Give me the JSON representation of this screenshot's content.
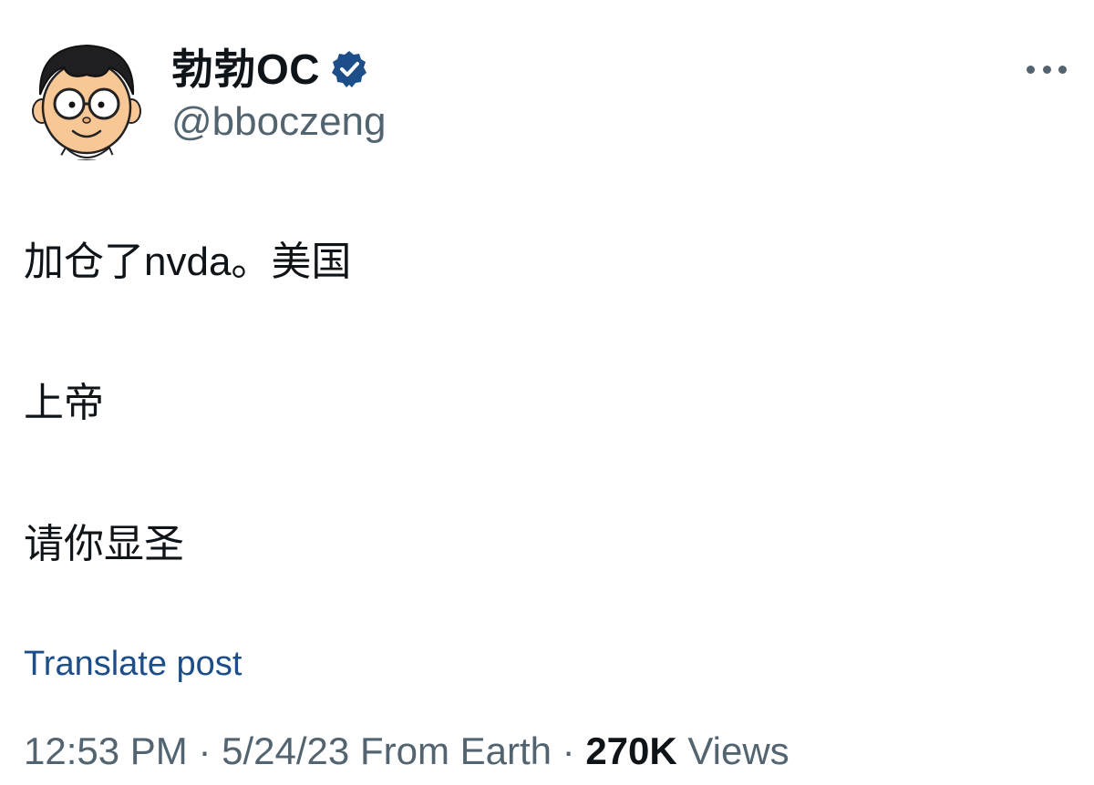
{
  "author": {
    "display_name": "勃勃OC",
    "handle": "@bboczeng",
    "verified": true,
    "avatar_icon": "cartoon-boy-glasses-avatar",
    "verified_color": "#1d4e89"
  },
  "post": {
    "lines": [
      "加仓了nvda。美国",
      "上帝",
      "请你显圣"
    ],
    "translate_label": "Translate post"
  },
  "meta": {
    "time": "12:53 PM",
    "separator": "·",
    "date": "5/24/23",
    "source": "From Earth",
    "views_count": "270K",
    "views_label": "Views"
  },
  "more_icon": "more-horizontal-icon",
  "colors": {
    "text_primary": "#0f1419",
    "text_secondary": "#536471",
    "link": "#1d4e89"
  }
}
